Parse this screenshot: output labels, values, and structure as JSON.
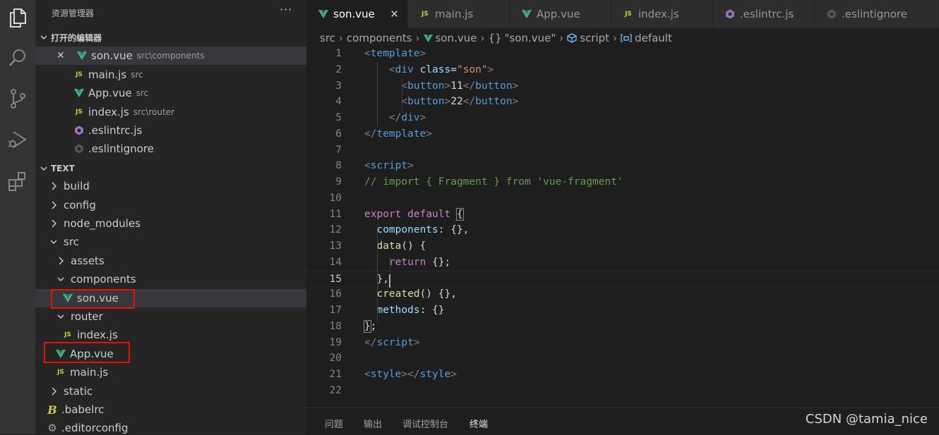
{
  "colors": {
    "vue": "#41b883",
    "js": "#cbcb41",
    "eslint": "#a074c4",
    "highlight_box": "#e51400"
  },
  "activity_bar": [
    {
      "name": "explorer-icon"
    },
    {
      "name": "search-icon"
    },
    {
      "name": "source-control-icon"
    },
    {
      "name": "run-debug-icon"
    },
    {
      "name": "extensions-icon"
    }
  ],
  "sidebar": {
    "title": "资源管理器",
    "more": "···",
    "open_editors": {
      "header": "打开的编辑器",
      "items": [
        {
          "name": "son.vue",
          "desc": "src\\components",
          "icon": "vue-icon",
          "close": "✕"
        },
        {
          "name": "main.js",
          "desc": "src",
          "icon": "js-icon"
        },
        {
          "name": "App.vue",
          "desc": "src",
          "icon": "vue-icon"
        },
        {
          "name": "index.js",
          "desc": "src\\router",
          "icon": "js-icon"
        },
        {
          "name": ".eslintrc.js",
          "desc": "",
          "icon": "eslint-icon"
        },
        {
          "name": ".eslintignore",
          "desc": "",
          "icon": "eslintignore-icon"
        }
      ]
    },
    "project": {
      "header": "TEXT",
      "items": [
        {
          "label": "build",
          "kind": "folder"
        },
        {
          "label": "config",
          "kind": "folder"
        },
        {
          "label": "node_modules",
          "kind": "folder"
        },
        {
          "label": "src",
          "kind": "folder-open"
        },
        {
          "label": "assets",
          "kind": "folder"
        },
        {
          "label": "components",
          "kind": "folder-open"
        },
        {
          "label": "son.vue",
          "kind": "vue"
        },
        {
          "label": "router",
          "kind": "folder-open"
        },
        {
          "label": "index.js",
          "kind": "js"
        },
        {
          "label": "App.vue",
          "kind": "vue"
        },
        {
          "label": "main.js",
          "kind": "js"
        },
        {
          "label": "static",
          "kind": "folder"
        },
        {
          "label": ".babelrc",
          "kind": "babel"
        },
        {
          "label": ".editorconfig",
          "kind": "gear"
        }
      ]
    }
  },
  "tabs": [
    {
      "label": "son.vue",
      "icon": "vue-icon",
      "active": true,
      "close": "✕"
    },
    {
      "label": "main.js",
      "icon": "js-icon"
    },
    {
      "label": "App.vue",
      "icon": "vue-icon"
    },
    {
      "label": "index.js",
      "icon": "js-icon"
    },
    {
      "label": ".eslintrc.js",
      "icon": "eslint-icon"
    },
    {
      "label": ".eslintignore",
      "icon": "eslintignore-icon"
    }
  ],
  "breadcrumb": {
    "src": "src",
    "components": "components",
    "file": "son.vue",
    "block": "\"son.vue\"",
    "block_icon": "{}",
    "script": "script",
    "default": "default"
  },
  "editor": {
    "current_line": 15,
    "lines": [
      [
        [
          "c-br",
          "<"
        ],
        [
          "c-tag",
          "template"
        ],
        [
          "c-br",
          ">"
        ]
      ],
      [
        [
          "c-pl",
          "    "
        ],
        [
          "c-br",
          "<"
        ],
        [
          "c-tag",
          "div"
        ],
        [
          "c-pl",
          " "
        ],
        [
          "c-attr",
          "class"
        ],
        [
          "c-pl",
          "="
        ],
        [
          "c-str",
          "\"son\""
        ],
        [
          "c-br",
          ">"
        ]
      ],
      [
        [
          "c-pl",
          "      "
        ],
        [
          "c-br",
          "<"
        ],
        [
          "c-tag",
          "button"
        ],
        [
          "c-br",
          ">"
        ],
        [
          "c-pl",
          "11"
        ],
        [
          "c-br",
          "</"
        ],
        [
          "c-tag",
          "button"
        ],
        [
          "c-br",
          ">"
        ]
      ],
      [
        [
          "c-pl",
          "      "
        ],
        [
          "c-br",
          "<"
        ],
        [
          "c-tag",
          "button"
        ],
        [
          "c-br",
          ">"
        ],
        [
          "c-pl",
          "22"
        ],
        [
          "c-br",
          "</"
        ],
        [
          "c-tag",
          "button"
        ],
        [
          "c-br",
          ">"
        ]
      ],
      [
        [
          "c-pl",
          "    "
        ],
        [
          "c-br",
          "</"
        ],
        [
          "c-tag",
          "div"
        ],
        [
          "c-br",
          ">"
        ]
      ],
      [
        [
          "c-br",
          "</"
        ],
        [
          "c-tag",
          "template"
        ],
        [
          "c-br",
          ">"
        ]
      ],
      [],
      [
        [
          "c-br",
          "<"
        ],
        [
          "c-tag",
          "script"
        ],
        [
          "c-br",
          ">"
        ]
      ],
      [
        [
          "c-cm",
          "// import { Fragment } from 'vue-fragment'"
        ]
      ],
      [],
      [
        [
          "c-kw",
          "export"
        ],
        [
          "c-pl",
          " "
        ],
        [
          "c-kw",
          "default"
        ],
        [
          "c-pl",
          " "
        ],
        [
          "c-pl c-bb",
          "{"
        ]
      ],
      [
        [
          "c-pl",
          "  "
        ],
        [
          "c-attr",
          "components"
        ],
        [
          "c-pl",
          ": {},"
        ]
      ],
      [
        [
          "c-pl",
          "  "
        ],
        [
          "c-fn",
          "data"
        ],
        [
          "c-pl",
          "() {"
        ]
      ],
      [
        [
          "c-pl",
          "    "
        ],
        [
          "c-kw",
          "return"
        ],
        [
          "c-pl",
          " {};"
        ]
      ],
      [
        [
          "c-pl",
          "  },"
        ]
      ],
      [
        [
          "c-pl",
          "  "
        ],
        [
          "c-fn",
          "created"
        ],
        [
          "c-pl",
          "() {},"
        ]
      ],
      [
        [
          "c-pl",
          "  "
        ],
        [
          "c-attr",
          "methods"
        ],
        [
          "c-pl",
          ": {}"
        ]
      ],
      [
        [
          "c-pl c-bb",
          "}"
        ],
        [
          "c-pl",
          ";"
        ]
      ],
      [
        [
          "c-br",
          "</"
        ],
        [
          "c-tag",
          "script"
        ],
        [
          "c-br",
          ">"
        ]
      ],
      [],
      [
        [
          "c-br",
          "<"
        ],
        [
          "c-tag",
          "style"
        ],
        [
          "c-br",
          "></"
        ],
        [
          "c-tag",
          "style"
        ],
        [
          "c-br",
          ">"
        ]
      ],
      []
    ]
  },
  "panel": {
    "tabs": [
      "问题",
      "输出",
      "调试控制台",
      "终端"
    ],
    "active": 3
  },
  "watermark": "CSDN @tamia_nice"
}
